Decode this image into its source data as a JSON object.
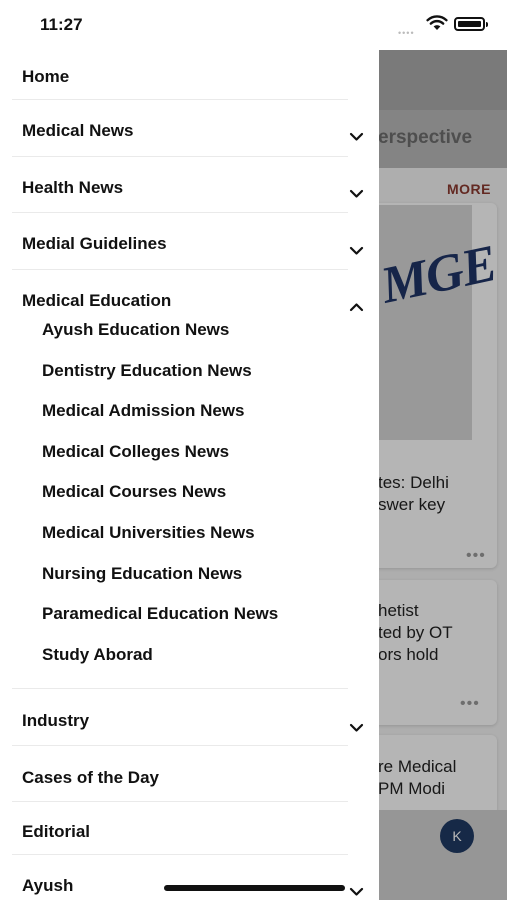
{
  "status_bar": {
    "time": "11:27"
  },
  "drawer": {
    "items_top": [
      {
        "label": "Home",
        "has_chevron": false
      },
      {
        "label": "Medical News",
        "has_chevron": true
      },
      {
        "label": "Health News",
        "has_chevron": true
      },
      {
        "label": "Medial Guidelines",
        "has_chevron": true
      },
      {
        "label": "Medical Education",
        "has_chevron": true,
        "expanded": true
      }
    ],
    "medical_education_subitems": [
      "Ayush Education News",
      "Dentistry Education News",
      "Medical Admission News",
      "Medical Colleges News",
      "Medical Courses News",
      "Medical Universities News",
      "Nursing Education News",
      "Paramedical Education News",
      "Study Aborad"
    ],
    "items_bottom": [
      {
        "label": "Industry",
        "has_chevron": true
      },
      {
        "label": "Cases of the Day",
        "has_chevron": false
      },
      {
        "label": "Editorial",
        "has_chevron": false
      },
      {
        "label": "Ayush",
        "has_chevron": true
      }
    ]
  },
  "background": {
    "tab_text": "erspective",
    "more_label": "MORE",
    "logo_text": "MGE",
    "card1_text": "tes: Delhi\nswer key",
    "card2_text": "hetist\nted by OT\nors hold",
    "card3_text": "re Medical\nPM Modi",
    "avatar_letter": "K"
  },
  "colors": {
    "accent": "#8a3a30",
    "avatar_bg": "#1f3a63",
    "logo": "#1f3466"
  }
}
